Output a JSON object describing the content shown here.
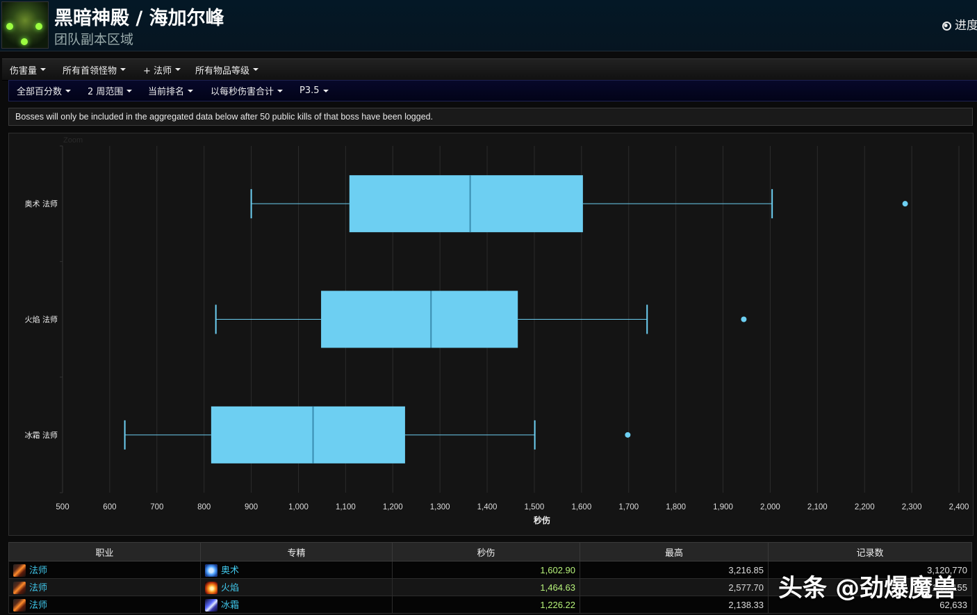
{
  "header": {
    "title": "黑暗神殿 / 海加尔峰",
    "subtitle": "团队副本区域",
    "progress_link": "进度"
  },
  "filters_row1": [
    "伤害量",
    "所有首领怪物",
    "+ 法师",
    "所有物品等级"
  ],
  "filters_row2": [
    "全部百分数",
    "2 周范围",
    "当前排名",
    "以每秒伤害合计",
    "P3.5"
  ],
  "notice": "Bosses will only be included in the aggregated data below after 50 public kills of that boss have been logged.",
  "chart_zoom_label": "Zoom",
  "chart_data": {
    "type": "boxplot",
    "orientation": "horizontal",
    "xlabel": "秒伤",
    "xlim": [
      500,
      2400
    ],
    "xticks": [
      500,
      600,
      700,
      800,
      900,
      1000,
      1100,
      1200,
      1300,
      1400,
      1500,
      1600,
      1700,
      1800,
      1900,
      2000,
      2100,
      2200,
      2300,
      2400
    ],
    "xtick_labels": [
      "500",
      "600",
      "700",
      "800",
      "900",
      "1,000",
      "1,100",
      "1,200",
      "1,300",
      "1,400",
      "1,500",
      "1,600",
      "1,700",
      "1,800",
      "1,900",
      "2,000",
      "2,100",
      "2,200",
      "2,300",
      "2,400"
    ],
    "categories": [
      "奥术 法师",
      "火焰 法师",
      "冰霜 法师"
    ],
    "boxes": [
      {
        "low": 900,
        "q1": 1108,
        "median": 1364,
        "q3": 1603,
        "high": 2004,
        "outliers": [
          2286
        ]
      },
      {
        "low": 825,
        "q1": 1048,
        "median": 1281,
        "q3": 1465,
        "high": 1739,
        "outliers": [
          1944
        ]
      },
      {
        "low": 632,
        "q1": 815,
        "median": 1031,
        "q3": 1226,
        "high": 1501,
        "outliers": [
          1698
        ]
      }
    ],
    "color": "#6dcff2",
    "grid": true,
    "legend": "none"
  },
  "table": {
    "headers": [
      "职业",
      "专精",
      "秒伤",
      "最高",
      "记录数"
    ],
    "rows": [
      {
        "class": "法师",
        "spec": "奥术",
        "spec_icon": "arcane-icon",
        "dps": "1,602.90",
        "max": "3,216.85",
        "records": "3,120,770"
      },
      {
        "class": "法师",
        "spec": "火焰",
        "spec_icon": "fire-icon",
        "dps": "1,464.63",
        "max": "2,577.70",
        "records": "1,9..,155"
      },
      {
        "class": "法师",
        "spec": "冰霜",
        "spec_icon": "frost-icon",
        "dps": "1,226.22",
        "max": "2,138.33",
        "records": "62,633"
      }
    ]
  },
  "watermark": "头条 @劲爆魔兽"
}
